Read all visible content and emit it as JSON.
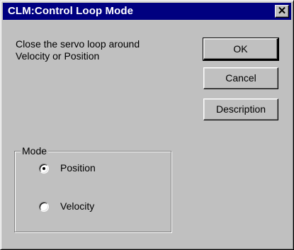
{
  "window": {
    "title": "CLM:Control Loop Mode",
    "close_glyph": "✕"
  },
  "message": "Close the servo loop around\nVelocity or Position",
  "buttons": {
    "ok_label": "OK",
    "cancel_label": "Cancel",
    "description_label": "Description"
  },
  "mode_group": {
    "label": "Mode",
    "options": [
      {
        "label": "Position",
        "selected": true
      },
      {
        "label": "Velocity",
        "selected": false
      }
    ]
  },
  "colors": {
    "titlebar": "#000080",
    "face": "#c0c0c0"
  }
}
